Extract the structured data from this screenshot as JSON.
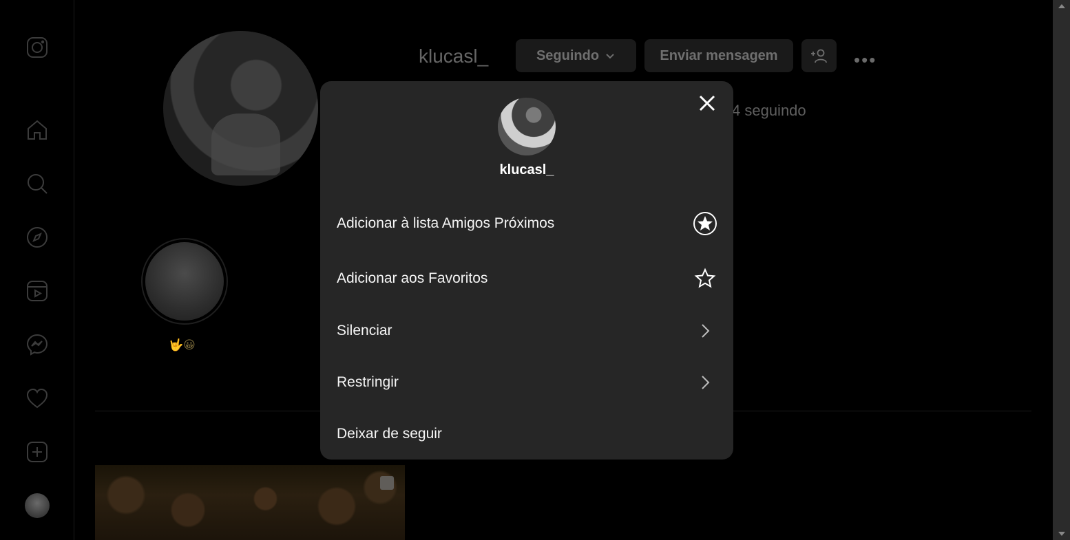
{
  "sidebar": {
    "icons": [
      "instagram-logo-icon",
      "home-icon",
      "search-icon",
      "explore-icon",
      "reels-icon",
      "messenger-icon",
      "heart-icon",
      "create-icon",
      "profile-avatar"
    ]
  },
  "profile": {
    "username": "klucasl_",
    "following_button": "Seguindo",
    "message_button": "Enviar mensagem",
    "more": "•••",
    "following_count": "4 seguindo",
    "highlight_label": "🤟😀"
  },
  "modal": {
    "username": "klucasl_",
    "items": [
      {
        "label": "Adicionar à lista Amigos Próximos",
        "icon": "close-friends-star-icon"
      },
      {
        "label": "Adicionar aos Favoritos",
        "icon": "star-outline-icon"
      },
      {
        "label": "Silenciar",
        "icon": "chevron-right-icon"
      },
      {
        "label": "Restringir",
        "icon": "chevron-right-icon"
      },
      {
        "label": "Deixar de seguir",
        "icon": ""
      }
    ]
  },
  "colors": {
    "background": "#000000",
    "modal_bg": "#262626",
    "text": "#f5f5f5"
  }
}
